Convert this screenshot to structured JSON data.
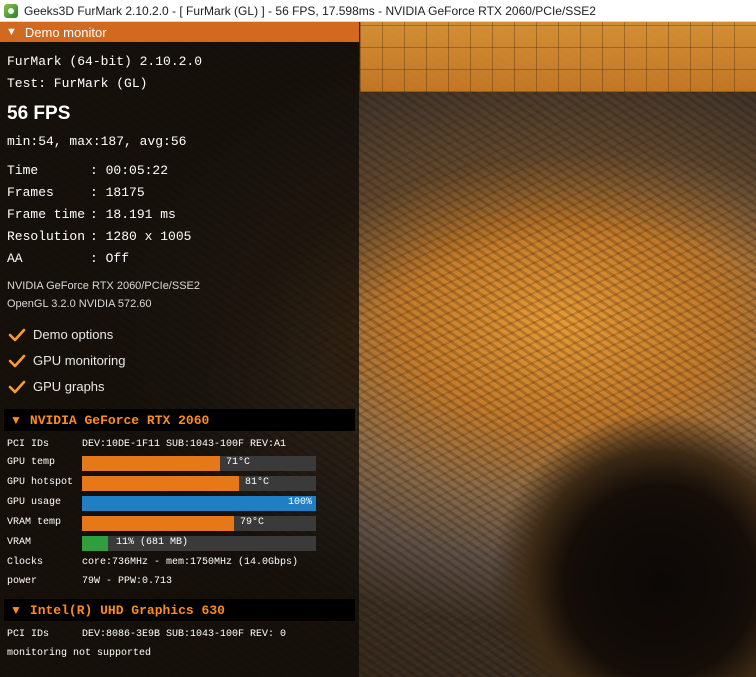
{
  "window": {
    "title": "Geeks3D FurMark 2.10.2.0 - [ FurMark (GL) ] - 56 FPS, 17.598ms - NVIDIA GeForce RTX 2060/PCIe/SSE2"
  },
  "panel": {
    "header": "Demo monitor",
    "app_line": "FurMark (64-bit) 2.10.2.0",
    "test_line": "Test: FurMark (GL)",
    "fps": "56 FPS",
    "fps_stats": "min:54, max:187, avg:56",
    "stats": [
      {
        "label": "Time",
        "value": "00:05:22"
      },
      {
        "label": "Frames",
        "value": "18175"
      },
      {
        "label": "Frame time",
        "value": "18.191 ms"
      },
      {
        "label": "Resolution",
        "value": "1280 x 1005"
      },
      {
        "label": "AA",
        "value": "Off"
      }
    ],
    "renderer": "NVIDIA GeForce RTX 2060/PCIe/SSE2",
    "opengl": "OpenGL 3.2.0 NVIDIA 572.60",
    "checkboxes": [
      {
        "label": "Demo options",
        "checked": true
      },
      {
        "label": "GPU monitoring",
        "checked": true
      },
      {
        "label": "GPU graphs",
        "checked": true
      }
    ]
  },
  "gpu1": {
    "name": "NVIDIA GeForce RTX 2060",
    "pci_label": "PCI IDs",
    "pci_value": "DEV:10DE-1F11 SUB:1043-100F REV:A1",
    "bars": [
      {
        "label": "GPU temp",
        "value": "71°C",
        "fill": 0.59,
        "color": "#e67817"
      },
      {
        "label": "GPU hotspot",
        "value": "81°C",
        "fill": 0.67,
        "color": "#e67817"
      },
      {
        "label": "GPU usage",
        "value": "100%",
        "fill": 1.0,
        "color": "#1f7fc4"
      },
      {
        "label": "VRAM temp",
        "value": "79°C",
        "fill": 0.65,
        "color": "#e67817"
      },
      {
        "label": "VRAM",
        "value": "11% (681 MB)",
        "fill": 0.11,
        "color": "#2e9e3e"
      }
    ],
    "clocks_label": "Clocks",
    "clocks_value": "core:736MHz - mem:1750MHz (14.0Gbps)",
    "power_label": "power",
    "power_value": "79W - PPW:0.713"
  },
  "gpu2": {
    "name": "Intel(R) UHD Graphics 630",
    "pci_label": "PCI IDs",
    "pci_value": "DEV:8086-3E9B SUB:1043-100F REV: 0",
    "note": "monitoring not supported"
  },
  "colors": {
    "accent": "#ff8c1a",
    "header": "#d2691e"
  }
}
